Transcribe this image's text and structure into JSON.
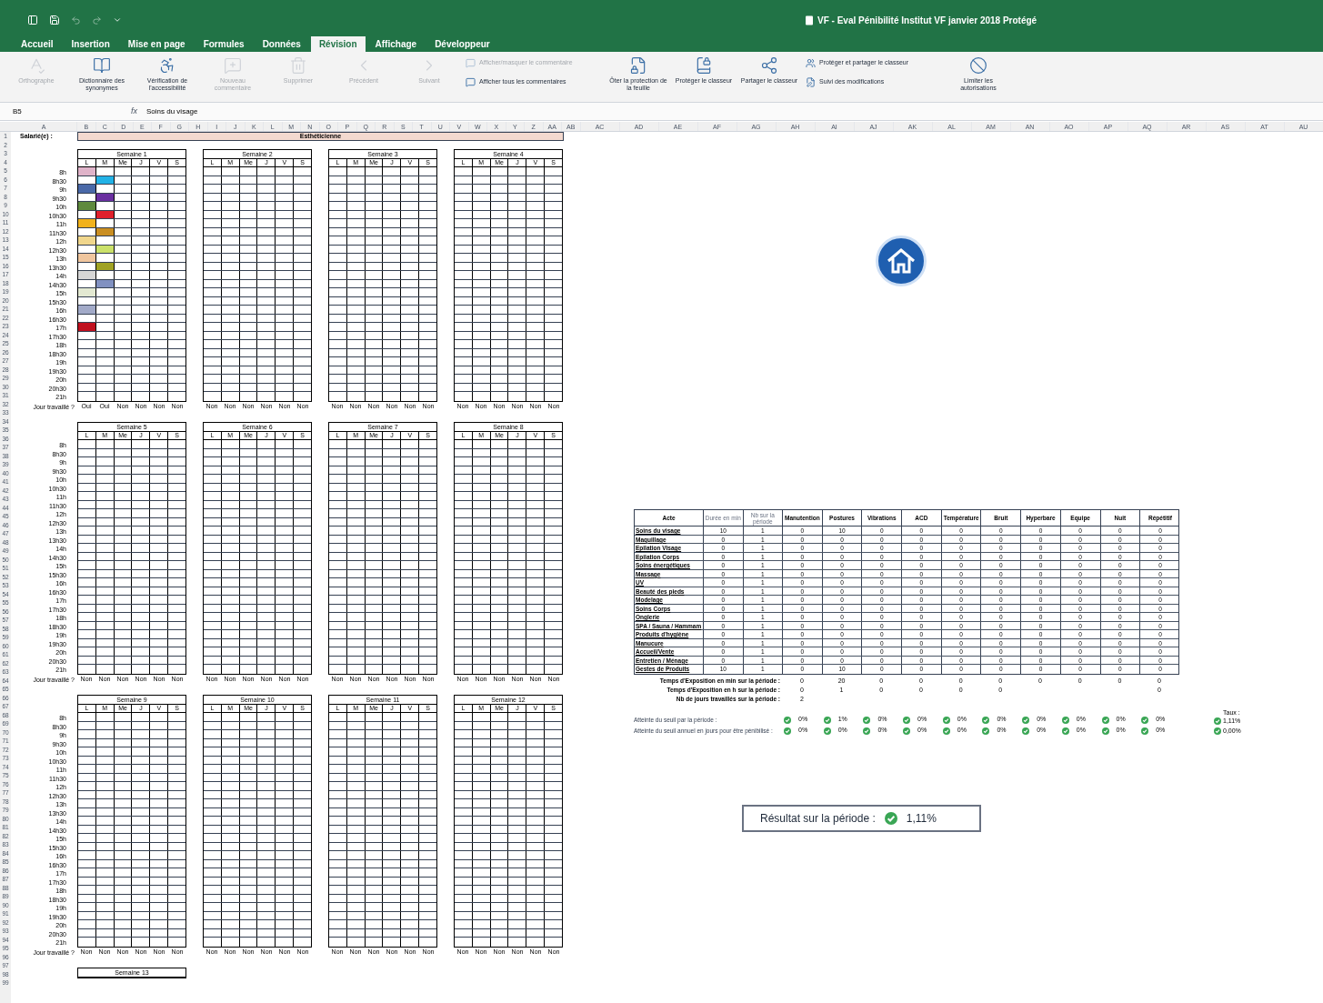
{
  "title_bar": {
    "title": "VF - Eval Pénibilité Institut VF janvier 2018 Protégé"
  },
  "tabs": [
    {
      "label": "Accueil",
      "selected": false
    },
    {
      "label": "Insertion",
      "selected": false
    },
    {
      "label": "Mise en page",
      "selected": false
    },
    {
      "label": "Formules",
      "selected": false
    },
    {
      "label": "Données",
      "selected": false
    },
    {
      "label": "Révision",
      "selected": true
    },
    {
      "label": "Affichage",
      "selected": false
    },
    {
      "label": "Développeur",
      "selected": false
    }
  ],
  "ribbon": [
    {
      "kind": "large",
      "label": "Orthographe",
      "disabled": true
    },
    {
      "kind": "large",
      "label": "Dictionnaire des synonymes",
      "disabled": false
    },
    {
      "kind": "large",
      "label": "Vérification de l'accessibilité",
      "disabled": false
    },
    {
      "kind": "large",
      "label": "Nouveau commentaire",
      "disabled": true
    },
    {
      "kind": "large",
      "label": "Supprimer",
      "disabled": true
    },
    {
      "kind": "large",
      "label": "Précédent",
      "disabled": true
    },
    {
      "kind": "large",
      "label": "Suivant",
      "disabled": true
    },
    {
      "kind": "stack",
      "items": [
        {
          "label": "Afficher/masquer le commentaire",
          "disabled": true
        },
        {
          "label": "Afficher tous les commentaires",
          "disabled": false
        }
      ]
    },
    {
      "kind": "large",
      "label": "Ôter la protection de la feuille",
      "disabled": false
    },
    {
      "kind": "large",
      "label": "Protéger le classeur",
      "disabled": false
    },
    {
      "kind": "large",
      "label": "Partager le classeur",
      "disabled": false
    },
    {
      "kind": "stack",
      "items": [
        {
          "label": "Protéger et partager le classeur",
          "disabled": false
        },
        {
          "label": "Suivi des modifications",
          "disabled": false
        }
      ]
    },
    {
      "kind": "large",
      "label": "Limiter les autorisations",
      "disabled": false
    }
  ],
  "formula_bar": {
    "name_box": "B5",
    "fx": "fx",
    "value": "Soins du visage"
  },
  "sheet": {
    "columns": [
      "A",
      "B",
      "C",
      "D",
      "E",
      "F",
      "G",
      "H",
      "I",
      "J",
      "K",
      "L",
      "M",
      "N",
      "O",
      "P",
      "Q",
      "R",
      "S",
      "T",
      "U",
      "V",
      "W",
      "X",
      "Y",
      "Z",
      "AA",
      "AB",
      "AC",
      "AD",
      "AE",
      "AF",
      "AG",
      "AH",
      "AI",
      "AJ",
      "AK",
      "AL",
      "AM",
      "AN",
      "AO",
      "AP",
      "AQ",
      "AR",
      "AS",
      "AT",
      "AU"
    ],
    "row_numbers": [
      "1",
      "2",
      "3",
      "4",
      "5",
      "6",
      "7",
      "8",
      "9",
      "10",
      "11",
      "12",
      "13",
      "14",
      "15",
      "16",
      "17",
      "18",
      "19",
      "20",
      "21",
      "22",
      "23",
      "24",
      "25",
      "26",
      "27",
      "28",
      "29",
      "30",
      "31",
      "32",
      "33",
      "34",
      "35",
      "36",
      "37",
      "38",
      "39",
      "40",
      "41",
      "42",
      "43",
      "44",
      "45",
      "46",
      "47",
      "48",
      "49",
      "50",
      "51",
      "52",
      "53",
      "54",
      "55",
      "56",
      "57",
      "58",
      "59",
      "60",
      "61",
      "62",
      "63",
      "64",
      "65",
      "66",
      "67",
      "68",
      "69",
      "70",
      "71",
      "72",
      "73",
      "74",
      "75",
      "76",
      "77",
      "78",
      "79",
      "80",
      "81",
      "82",
      "83",
      "84",
      "85",
      "86",
      "87",
      "88",
      "89",
      "90",
      "91",
      "92",
      "93",
      "94",
      "95",
      "96",
      "97",
      "98",
      "99"
    ],
    "employee_label": "Salarié(e) :",
    "employee_name": "Esthéticienne",
    "blocks": [
      {
        "time_slots": [
          "8h",
          "8h30",
          "9h",
          "9h30",
          "10h",
          "10h30",
          "11h",
          "11h30",
          "12h",
          "12h30",
          "13h",
          "13h30",
          "14h",
          "14h30",
          "15h",
          "15h30",
          "16h",
          "16h30",
          "17h",
          "17h30",
          "18h",
          "18h30",
          "19h",
          "19h30",
          "20h",
          "20h30",
          "21h"
        ],
        "worked_label": "Jour travaillé ?",
        "weeks": [
          {
            "title": "Semaine 1",
            "days": [
              "L",
              "M",
              "Me",
              "J",
              "V",
              "S"
            ],
            "worked": [
              "Oui",
              "Oui",
              "Non",
              "Non",
              "Non",
              "Non"
            ],
            "slots": [
              {
                "cells": [
                  {
                    "color": "#dfb3c9"
                  },
                  {
                    "color": "#ffffff"
                  }
                ]
              },
              {
                "cells": [
                  {
                    "color": "#ffffff"
                  },
                  {
                    "color": "#22b2e6"
                  }
                ]
              },
              {
                "cells": [
                  {
                    "color": "#4a69a8"
                  },
                  {
                    "color": "#ffffff"
                  }
                ]
              },
              {
                "cells": [
                  {
                    "color": "#ffffff"
                  },
                  {
                    "color": "#6a2fa0"
                  }
                ]
              },
              {
                "cells": [
                  {
                    "color": "#5f8a3e"
                  },
                  {
                    "color": "#ffffff"
                  }
                ]
              },
              {
                "cells": [
                  {
                    "color": "#ffffff"
                  },
                  {
                    "color": "#e0202c"
                  }
                ]
              },
              {
                "cells": [
                  {
                    "color": "#f1b21c"
                  },
                  {
                    "color": "#ffffff"
                  }
                ]
              },
              {
                "cells": [
                  {
                    "color": "#ffffff"
                  },
                  {
                    "color": "#c98e22"
                  }
                ]
              },
              {
                "cells": [
                  {
                    "color": "#f0d68c"
                  },
                  {
                    "color": "#ffffff"
                  }
                ]
              },
              {
                "cells": [
                  {
                    "color": "#ffffff"
                  },
                  {
                    "color": "#cbe16a"
                  }
                ]
              },
              {
                "cells": [
                  {
                    "color": "#f0c69e"
                  },
                  {
                    "color": "#ffffff"
                  }
                ]
              },
              {
                "cells": [
                  {
                    "color": "#ffffff"
                  },
                  {
                    "color": "#a0a224"
                  }
                ]
              },
              {
                "cells": [
                  {
                    "color": "#d6d6d6"
                  },
                  {
                    "color": "#ffffff"
                  }
                ]
              },
              {
                "cells": [
                  {
                    "color": "#ffffff"
                  },
                  {
                    "color": "#8191c1"
                  }
                ]
              },
              {
                "cells": [
                  {
                    "color": "#e3e9d2"
                  },
                  {
                    "color": "#ffffff"
                  }
                ]
              },
              {
                "cells": [
                  {
                    "color": "#ffffff"
                  },
                  {
                    "color": "#ffffff"
                  }
                ]
              },
              {
                "cells": [
                  {
                    "color": "#a2aac8"
                  },
                  {
                    "color": "#ffffff"
                  }
                ]
              },
              {
                "cells": [
                  {
                    "color": "#ffffff"
                  },
                  {
                    "color": "#ffffff"
                  }
                ]
              },
              {
                "cells": [
                  {
                    "color": "#c0101f"
                  },
                  {
                    "color": "#ffffff"
                  }
                ]
              }
            ]
          },
          {
            "title": "Semaine 2",
            "days": [
              "L",
              "M",
              "Me",
              "J",
              "V",
              "S"
            ],
            "worked": [
              "Non",
              "Non",
              "Non",
              "Non",
              "Non",
              "Non"
            ]
          },
          {
            "title": "Semaine 3",
            "days": [
              "L",
              "M",
              "Me",
              "J",
              "V",
              "S"
            ],
            "worked": [
              "Non",
              "Non",
              "Non",
              "Non",
              "Non",
              "Non"
            ]
          },
          {
            "title": "Semaine 4",
            "days": [
              "L",
              "M",
              "Me",
              "J",
              "V",
              "S"
            ],
            "worked": [
              "Non",
              "Non",
              "Non",
              "Non",
              "Non",
              "Non"
            ]
          }
        ]
      },
      {
        "time_slots": [
          "8h",
          "8h30",
          "9h",
          "9h30",
          "10h",
          "10h30",
          "11h",
          "11h30",
          "12h",
          "12h30",
          "13h",
          "13h30",
          "14h",
          "14h30",
          "15h",
          "15h30",
          "16h",
          "16h30",
          "17h",
          "17h30",
          "18h",
          "18h30",
          "19h",
          "19h30",
          "20h",
          "20h30",
          "21h"
        ],
        "worked_label": "Jour travaillé ?",
        "weeks": [
          {
            "title": "Semaine 5",
            "days": [
              "L",
              "M",
              "Me",
              "J",
              "V",
              "S"
            ],
            "worked": [
              "Non",
              "Non",
              "Non",
              "Non",
              "Non",
              "Non"
            ]
          },
          {
            "title": "Semaine 6",
            "days": [
              "L",
              "M",
              "Me",
              "J",
              "V",
              "S"
            ],
            "worked": [
              "Non",
              "Non",
              "Non",
              "Non",
              "Non",
              "Non"
            ]
          },
          {
            "title": "Semaine 7",
            "days": [
              "L",
              "M",
              "Me",
              "J",
              "V",
              "S"
            ],
            "worked": [
              "Non",
              "Non",
              "Non",
              "Non",
              "Non",
              "Non"
            ]
          },
          {
            "title": "Semaine 8",
            "days": [
              "L",
              "M",
              "Me",
              "J",
              "V",
              "S"
            ],
            "worked": [
              "Non",
              "Non",
              "Non",
              "Non",
              "Non",
              "Non"
            ]
          }
        ]
      },
      {
        "time_slots": [
          "8h",
          "8h30",
          "9h",
          "9h30",
          "10h",
          "10h30",
          "11h",
          "11h30",
          "12h",
          "12h30",
          "13h",
          "13h30",
          "14h",
          "14h30",
          "15h",
          "15h30",
          "16h",
          "16h30",
          "17h",
          "17h30",
          "18h",
          "18h30",
          "19h",
          "19h30",
          "20h",
          "20h30",
          "21h"
        ],
        "worked_label": "Jour travaillé ?",
        "weeks": [
          {
            "title": "Semaine 9",
            "days": [
              "L",
              "M",
              "Me",
              "J",
              "V",
              "S"
            ],
            "worked": [
              "Non",
              "Non",
              "Non",
              "Non",
              "Non",
              "Non"
            ]
          },
          {
            "title": "Semaine 10",
            "days": [
              "L",
              "M",
              "Me",
              "J",
              "V",
              "S"
            ],
            "worked": [
              "Non",
              "Non",
              "Non",
              "Non",
              "Non",
              "Non"
            ]
          },
          {
            "title": "Semaine 11",
            "days": [
              "L",
              "M",
              "Me",
              "J",
              "V",
              "S"
            ],
            "worked": [
              "Non",
              "Non",
              "Non",
              "Non",
              "Non",
              "Non"
            ]
          },
          {
            "title": "Semaine 12",
            "days": [
              "L",
              "M",
              "Me",
              "J",
              "V",
              "S"
            ],
            "worked": [
              "Non",
              "Non",
              "Non",
              "Non",
              "Non",
              "Non"
            ]
          }
        ]
      },
      {
        "weeks": [
          {
            "title": "Semaine 13"
          }
        ]
      }
    ],
    "exposure_table": {
      "columns": [
        "Acte",
        "Durée en min",
        "Nb sur la période",
        "Manutention",
        "Postures",
        "Vibrations",
        "ACD",
        "Température",
        "Bruit",
        "Hyperbare",
        "Equipe",
        "Nuit",
        "Répétitif"
      ],
      "rows": [
        {
          "cells": [
            "Soins du visage",
            "10",
            "1",
            "0",
            "10",
            "0",
            "0",
            "0",
            "0",
            "0",
            "0",
            "0",
            "0"
          ]
        },
        {
          "cells": [
            "Maquillage",
            "0",
            "1",
            "0",
            "0",
            "0",
            "0",
            "0",
            "0",
            "0",
            "0",
            "0",
            "0"
          ]
        },
        {
          "cells": [
            "Epilation Visage",
            "0",
            "1",
            "0",
            "0",
            "0",
            "0",
            "0",
            "0",
            "0",
            "0",
            "0",
            "0"
          ]
        },
        {
          "cells": [
            "Epilation Corps",
            "0",
            "1",
            "0",
            "0",
            "0",
            "0",
            "0",
            "0",
            "0",
            "0",
            "0",
            "0"
          ]
        },
        {
          "cells": [
            "Soins énergétiques",
            "0",
            "1",
            "0",
            "0",
            "0",
            "0",
            "0",
            "0",
            "0",
            "0",
            "0",
            "0"
          ]
        },
        {
          "cells": [
            "Massage",
            "0",
            "1",
            "0",
            "0",
            "0",
            "0",
            "0",
            "0",
            "0",
            "0",
            "0",
            "0"
          ]
        },
        {
          "cells": [
            "UV",
            "0",
            "1",
            "0",
            "0",
            "0",
            "0",
            "0",
            "0",
            "0",
            "0",
            "0",
            "0"
          ]
        },
        {
          "cells": [
            "Beauté des pieds",
            "0",
            "1",
            "0",
            "0",
            "0",
            "0",
            "0",
            "0",
            "0",
            "0",
            "0",
            "0"
          ]
        },
        {
          "cells": [
            "Modelage",
            "0",
            "1",
            "0",
            "0",
            "0",
            "0",
            "0",
            "0",
            "0",
            "0",
            "0",
            "0"
          ]
        },
        {
          "cells": [
            "Soins Corps",
            "0",
            "1",
            "0",
            "0",
            "0",
            "0",
            "0",
            "0",
            "0",
            "0",
            "0",
            "0"
          ]
        },
        {
          "cells": [
            "Onglerie",
            "0",
            "1",
            "0",
            "0",
            "0",
            "0",
            "0",
            "0",
            "0",
            "0",
            "0",
            "0"
          ]
        },
        {
          "cells": [
            "SPA / Sauna / Hammam",
            "0",
            "1",
            "0",
            "0",
            "0",
            "0",
            "0",
            "0",
            "0",
            "0",
            "0",
            "0"
          ]
        },
        {
          "cells": [
            "Produits d'hygiène",
            "0",
            "1",
            "0",
            "0",
            "0",
            "0",
            "0",
            "0",
            "0",
            "0",
            "0",
            "0"
          ]
        },
        {
          "cells": [
            "Manucure",
            "0",
            "1",
            "0",
            "0",
            "0",
            "0",
            "0",
            "0",
            "0",
            "0",
            "0",
            "0"
          ]
        },
        {
          "cells": [
            "Accueil/Vente",
            "0",
            "1",
            "0",
            "0",
            "0",
            "0",
            "0",
            "0",
            "0",
            "0",
            "0",
            "0"
          ]
        },
        {
          "cells": [
            "Entretien / Ménage",
            "0",
            "1",
            "0",
            "0",
            "0",
            "0",
            "0",
            "0",
            "0",
            "0",
            "0",
            "0"
          ]
        },
        {
          "cells": [
            "Gestes de Produits",
            "10",
            "1",
            "0",
            "10",
            "0",
            "0",
            "0",
            "0",
            "0",
            "0",
            "0",
            "0"
          ]
        }
      ],
      "summary": [
        {
          "label": "Temps d'Exposition en min sur la période :",
          "values": [
            "0",
            "20",
            "0",
            "0",
            "0",
            "0",
            "0",
            "0",
            "0",
            "0"
          ]
        },
        {
          "label": "Temps d'Exposition en h sur la période :",
          "values": [
            "0",
            "1",
            "0",
            "0",
            "0",
            "0"
          ],
          "last_column_value": "0"
        },
        {
          "label": "Nb de jours travaillés sur la période :",
          "values": [
            "2"
          ]
        }
      ],
      "thresholds": [
        {
          "label": "Atteinte du seuil par la période :",
          "items": [
            {
              "passed": true,
              "value": "0%"
            },
            {
              "passed": true,
              "value": "1%"
            },
            {
              "passed": true,
              "value": "0%"
            },
            {
              "passed": true,
              "value": "0%"
            },
            {
              "passed": true,
              "value": "0%"
            },
            {
              "passed": true,
              "value": "0%"
            },
            {
              "passed": true,
              "value": "0%"
            },
            {
              "passed": true,
              "value": "0%"
            },
            {
              "passed": true,
              "value": "0%"
            },
            {
              "passed": true,
              "value": "0%"
            }
          ]
        },
        {
          "label": "Atteinte du seuil annuel en jours pour être pénibilisé :",
          "items": [
            {
              "passed": true,
              "value": "0%"
            },
            {
              "passed": true,
              "value": "0%"
            },
            {
              "passed": true,
              "value": "0%"
            },
            {
              "passed": true,
              "value": "0%"
            },
            {
              "passed": true,
              "value": "0%"
            },
            {
              "passed": true,
              "value": "0%"
            },
            {
              "passed": true,
              "value": "0%"
            },
            {
              "passed": true,
              "value": "0%"
            },
            {
              "passed": true,
              "value": "0%"
            },
            {
              "passed": true,
              "value": "0%"
            }
          ]
        }
      ],
      "rate": {
        "label": "Taux :",
        "items": [
          {
            "passed": true,
            "value": "1,11%"
          },
          {
            "passed": true,
            "value": "0,00%"
          }
        ]
      }
    },
    "result": {
      "label": "Résultat sur la période :",
      "passed": true,
      "value": "1,11%"
    }
  }
}
